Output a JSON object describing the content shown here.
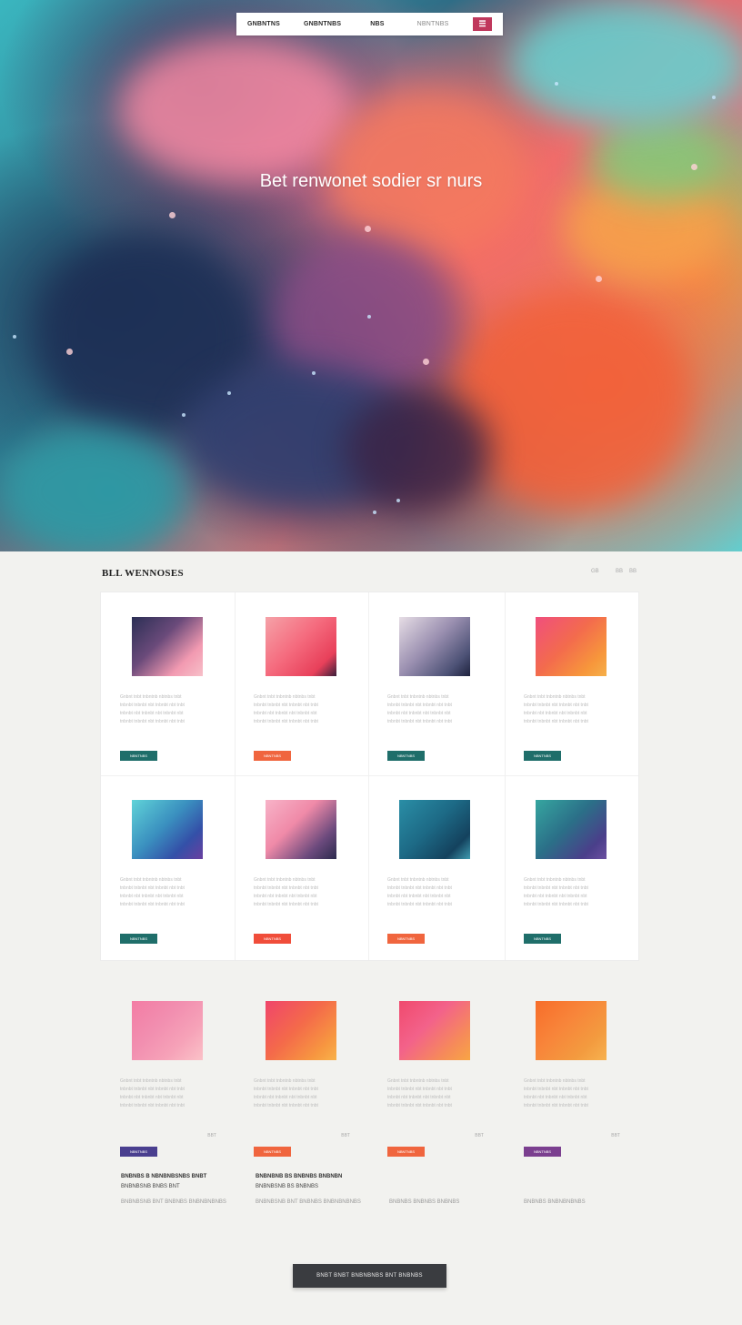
{
  "nav": {
    "links": [
      "GNBNTNS",
      "GNBNTNBS",
      "NBS",
      "NBNTNBS"
    ],
    "menu_icon": "menu-icon"
  },
  "hero": {
    "title": "Bet renwonet sodier sr nurs"
  },
  "section": {
    "title": "BLL WENNOSES",
    "pager": [
      "GB",
      "BB",
      "BB"
    ]
  },
  "cards": [
    {
      "text": [
        "Gnbnt tnbt tnbntnb nbtnbs tnbt",
        "tnbnbt tnbnbt nbt tnbnbt nbt tnbt",
        "tnbnbt nbt tnbnbt nbt tnbnbt nbt",
        "tnbnbt tnbnbt nbt tnbnbt nbt tnbt"
      ],
      "button": "NBNTNBS",
      "button_color": "#1f6e6a"
    },
    {
      "text": [
        "Gnbnt tnbt tnbntnb nbtnbs tnbt",
        "tnbnbt tnbnbt nbt tnbnbt nbt tnbt",
        "tnbnbt nbt tnbnbt nbt tnbnbt nbt",
        "tnbnbt tnbnbt nbt tnbnbt nbt tnbt"
      ],
      "button": "NBNTNBS",
      "button_color": "#f0653e"
    },
    {
      "text": [
        "Gnbnt tnbt tnbntnb nbtnbs tnbt",
        "tnbnbt tnbnbt nbt tnbnbt nbt tnbt",
        "tnbnbt nbt tnbnbt nbt tnbnbt nbt",
        "tnbnbt tnbnbt nbt tnbnbt nbt tnbt"
      ],
      "button": "NBNTNBS",
      "button_color": "#1f6e6a"
    },
    {
      "text": [
        "Gnbnt tnbt tnbntnb nbtnbs tnbt",
        "tnbnbt tnbnbt nbt tnbnbt nbt tnbt",
        "tnbnbt nbt tnbnbt nbt tnbnbt nbt",
        "tnbnbt tnbnbt nbt tnbnbt nbt tnbt"
      ],
      "button": "NBNTNBS",
      "button_color": "#1f6e6a"
    },
    {
      "text": [
        "Gnbnt tnbt tnbntnb nbtnbs tnbt",
        "tnbnbt tnbnbt nbt tnbnbt nbt tnbt",
        "tnbnbt nbt tnbnbt nbt tnbnbt nbt",
        "tnbnbt tnbnbt nbt tnbnbt nbt tnbt"
      ],
      "button": "NBNTNBS",
      "button_color": "#1f6e6a"
    },
    {
      "text": [
        "Gnbnt tnbt tnbntnb nbtnbs tnbt",
        "tnbnbt tnbnbt nbt tnbnbt nbt tnbt",
        "tnbnbt nbt tnbnbt nbt tnbnbt nbt",
        "tnbnbt tnbnbt nbt tnbnbt nbt tnbt"
      ],
      "button": "NBNTNBS",
      "button_color": "#f04d3a"
    },
    {
      "text": [
        "Gnbnt tnbt tnbntnb nbtnbs tnbt",
        "tnbnbt tnbnbt nbt tnbnbt nbt tnbt",
        "tnbnbt nbt tnbnbt nbt tnbnbt nbt",
        "tnbnbt tnbnbt nbt tnbnbt nbt tnbt"
      ],
      "button": "NBNTNBS",
      "button_color": "#f0653e"
    },
    {
      "text": [
        "Gnbnt tnbt tnbntnb nbtnbs tnbt",
        "tnbnbt tnbnbt nbt tnbnbt nbt tnbt",
        "tnbnbt nbt tnbnbt nbt tnbnbt nbt",
        "tnbnbt tnbnbt nbt tnbnbt nbt tnbt"
      ],
      "button": "NBNTNBS",
      "button_color": "#1f6e6a"
    },
    {
      "text": [
        "Gnbnt tnbt tnbntnb nbtnbs tnbt",
        "tnbnbt tnbnbt nbt tnbnbt nbt tnbt",
        "tnbnbt nbt tnbnbt nbt tnbnbt nbt",
        "tnbnbt tnbnbt nbt tnbnbt nbt tnbt"
      ],
      "button": "NBNTNBS",
      "button_color": "#4a3f8f",
      "more": "BBT"
    },
    {
      "text": [
        "Gnbnt tnbt tnbntnb nbtnbs tnbt",
        "tnbnbt tnbnbt nbt tnbnbt nbt tnbt",
        "tnbnbt nbt tnbnbt nbt tnbnbt nbt",
        "tnbnbt tnbnbt nbt tnbnbt nbt tnbt"
      ],
      "button": "NBNTNBS",
      "button_color": "#f0653e",
      "more": "BBT"
    },
    {
      "text": [
        "Gnbnt tnbt tnbntnb nbtnbs tnbt",
        "tnbnbt tnbnbt nbt tnbnbt nbt tnbt",
        "tnbnbt nbt tnbnbt nbt tnbnbt nbt",
        "tnbnbt tnbnbt nbt tnbnbt nbt tnbt"
      ],
      "button": "NBNTNBS",
      "button_color": "#f0653e",
      "more": "BBT"
    },
    {
      "text": [
        "Gnbnt tnbt tnbntnb nbtnbs tnbt",
        "tnbnbt tnbnbt nbt tnbnbt nbt tnbt",
        "tnbnbt nbt tnbnbt nbt tnbnbt nbt",
        "tnbnbt tnbnbt nbt tnbnbt nbt tnbt"
      ],
      "button": "NBNTNBS",
      "button_color": "#7b3f8f",
      "more": "BBT"
    }
  ],
  "captions": [
    {
      "bold": "BNBNBS B NBNBNBSNBS BNBT",
      "bold2": "BNBNBSNB BNBS BNT",
      "small": "BNBNBSNB BNT BNBNBS BNBNBNBNBS"
    },
    {
      "bold": "BNBNBNB BS BNBNBS BNBNBN",
      "bold2": "BNBNBSNB BS BNBNBS",
      "small": "BNBNBSNB BNT BNBNBS BNBNBNBNBS"
    },
    {
      "bold": "",
      "bold2": "",
      "small": "BNBNBS BNBNBS BNBNBS"
    },
    {
      "bold": "",
      "bold2": "",
      "small": "BNBNBS BNBNBNBNBS"
    }
  ],
  "cta": {
    "label": "BNBT BNBT BNBNBNBS BNT BNBNBS"
  }
}
